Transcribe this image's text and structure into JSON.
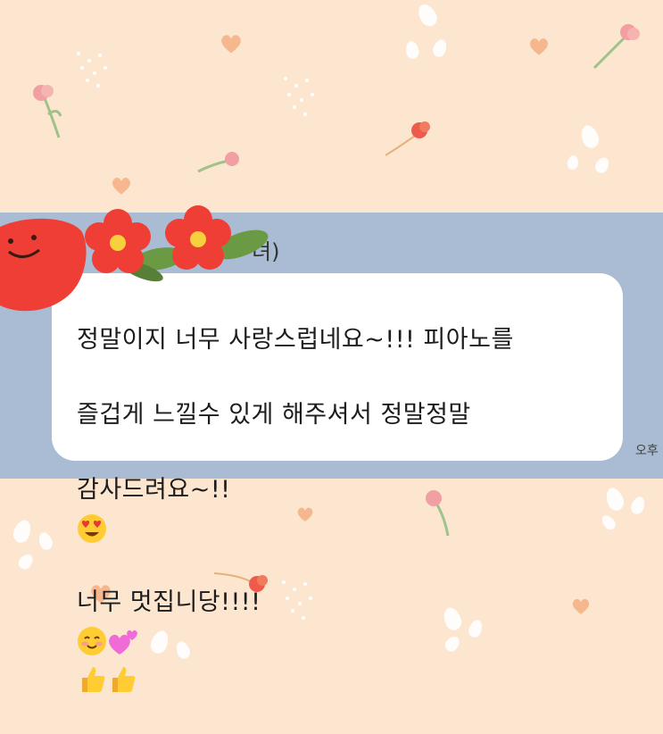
{
  "chat": {
    "sender_name_fragment": "녀)",
    "message_lines": [
      "정말이지 너무 사랑스럽네요~!!! 피아노를",
      "즐겁게 느낄수 있게 해주셔서 정말정말",
      "감사드려요~!!",
      "너무 멋집니당!!!!"
    ],
    "time_fragment": "오후"
  },
  "emojis": {
    "line3": "heart-eyes-emoji",
    "line4": [
      "smiling-blush-emoji",
      "two-hearts-emoji",
      "thumbs-up-emoji",
      "thumbs-up-emoji"
    ]
  },
  "colors": {
    "background": "#fde6d0",
    "band": "#a9bcd3",
    "bubble": "#ffffff",
    "flower_red": "#ef3e36",
    "leaf_green": "#6a9a43"
  }
}
